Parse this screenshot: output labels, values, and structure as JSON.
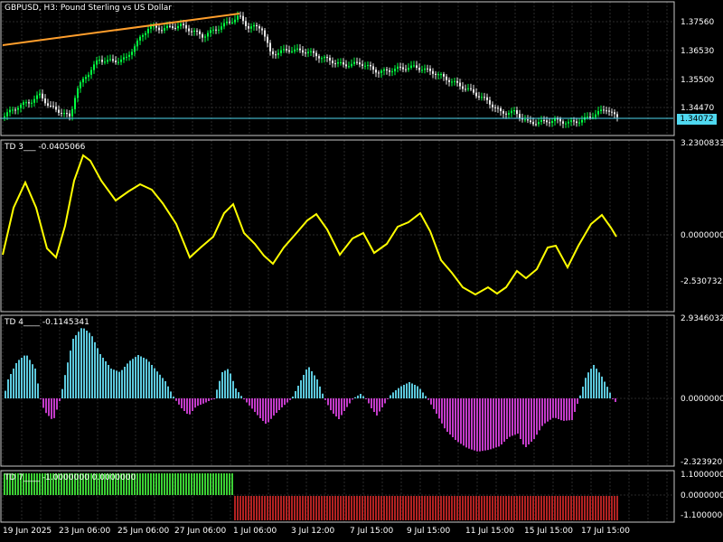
{
  "window": {
    "title": "GBPUSD, H3:  Pound Sterling vs US Dollar"
  },
  "colors": {
    "background": "#000000",
    "grid": "#2a2a2a",
    "border": "#c8c8c8",
    "bull_candle": "#00ff40",
    "bear_candle": "#e8e8e8",
    "trendline": "#ff9e2c",
    "bid_line": "#4fd8f0",
    "td3_line": "#ffff00",
    "td4_positive": "#5cc8dc",
    "td4_negative": "#c23bc8",
    "td7_positive": "#3bd034",
    "td7_negative": "#b22222"
  },
  "price_panel": {
    "axis_labels": [
      "1.37560",
      "1.36530",
      "1.35500",
      "1.34470"
    ],
    "current_price": "1.34072"
  },
  "td3_panel": {
    "title": "TD 3___ -0.0405066",
    "axis_labels": [
      "3.2300833",
      "0.0000000",
      "-2.5307322"
    ]
  },
  "td4_panel": {
    "title": "TD 4____ -0.1145341",
    "axis_labels": [
      "2.9346032",
      "0.0000000",
      "-2.3239202"
    ]
  },
  "td7_panel": {
    "title": "TD 7____ -1.0000000 0.0000000",
    "axis_labels": [
      "1.1000000",
      "0.0000000",
      "-1.1000000"
    ]
  },
  "time_axis": {
    "labels": [
      "19 Jun 2025",
      "23 Jun 06:00",
      "25 Jun 06:00",
      "27 Jun 06:00",
      "1 Jul 06:00",
      "3 Jul 12:00",
      "7 Jul 15:00",
      "9 Jul 15:00",
      "11 Jul 15:00",
      "15 Jul 15:00",
      "17 Jul 15:00"
    ]
  }
}
